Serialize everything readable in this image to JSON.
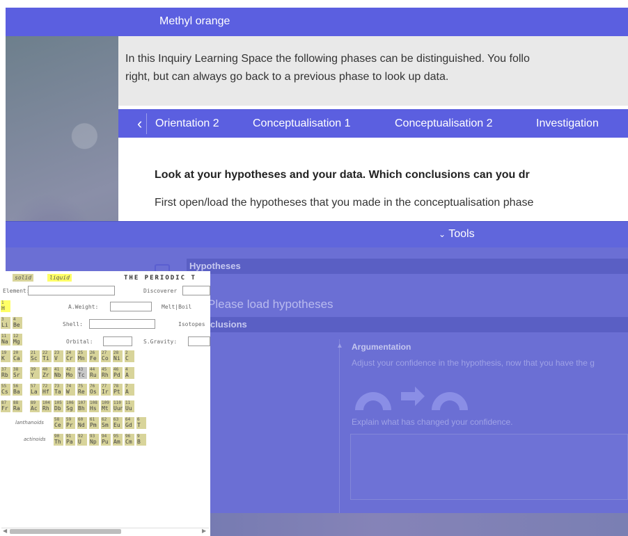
{
  "window": {
    "title": "Methyl orange"
  },
  "intro": {
    "line1": "In this Inquiry Learning Space the following phases can be distinguished. You follo",
    "line2": "right, but can always go back to a previous phase to look up data."
  },
  "phases": {
    "prev_icon": "chevron-left-icon",
    "tabs": [
      "Orientation 2",
      "Conceptualisation 1",
      "Conceptualisation 2",
      "Investigation"
    ]
  },
  "content": {
    "question": "Look at your hypotheses and your data. Which conclusions can you dr",
    "instruction": "First open/load the hypotheses that you made in the conceptualisation phase"
  },
  "tools": {
    "label": "Tools",
    "toggle_icon": "chevron-down-icon",
    "hypotheses": {
      "title": "Hypotheses",
      "empty_text": "Please load hypotheses"
    },
    "conclusions": {
      "title": "clusions",
      "argumentation_title": "Argumentation",
      "argumentation_hint": "Adjust your confidence in the hypothesis, now that you have the g",
      "explain_label": "Explain what has changed your confidence."
    }
  },
  "periodic_table": {
    "legend": {
      "solid": "solid",
      "liquid": "liquid"
    },
    "title": "THE PERIODIC T",
    "fields": {
      "element": "Element:",
      "discoverer": "Discoverer",
      "a_weight": "A.Weight:",
      "melt_boil": "Melt|Boil",
      "shell": "Shell:",
      "isotopes": "Isotopes",
      "orbital": "Orbital:",
      "s_gravity": "S.Gravity:"
    },
    "series": {
      "lanthanoids": "lanthanoids",
      "actinoids": "actinoids"
    },
    "colors": {
      "solid": "#d8d49a",
      "liquid": "#ffff66",
      "synthetic": "#c8c8c8",
      "gas": "#ffff66"
    },
    "cells": [
      {
        "n": "1",
        "s": "H"
      },
      {
        "n": "3",
        "s": "Li"
      },
      {
        "n": "4",
        "s": "Be"
      },
      {
        "n": "11",
        "s": "Na"
      },
      {
        "n": "12",
        "s": "Mg"
      },
      {
        "n": "19",
        "s": "K"
      },
      {
        "n": "20",
        "s": "Ca"
      },
      {
        "n": "21",
        "s": "Sc"
      },
      {
        "n": "22",
        "s": "Ti"
      },
      {
        "n": "23",
        "s": "V"
      },
      {
        "n": "24",
        "s": "Cr"
      },
      {
        "n": "25",
        "s": "Mn"
      },
      {
        "n": "26",
        "s": "Fe"
      },
      {
        "n": "27",
        "s": "Co"
      },
      {
        "n": "28",
        "s": "Ni"
      },
      {
        "n": "2",
        "s": "C"
      },
      {
        "n": "37",
        "s": "Rb"
      },
      {
        "n": "38",
        "s": "Sr"
      },
      {
        "n": "39",
        "s": "Y"
      },
      {
        "n": "40",
        "s": "Zr"
      },
      {
        "n": "41",
        "s": "Nb"
      },
      {
        "n": "42",
        "s": "Mo"
      },
      {
        "n": "43",
        "s": "Tc"
      },
      {
        "n": "44",
        "s": "Ru"
      },
      {
        "n": "45",
        "s": "Rh"
      },
      {
        "n": "46",
        "s": "Pd"
      },
      {
        "n": "4",
        "s": "A"
      },
      {
        "n": "55",
        "s": "Cs"
      },
      {
        "n": "56",
        "s": "Ba"
      },
      {
        "n": "57",
        "s": "La"
      },
      {
        "n": "72",
        "s": "Hf"
      },
      {
        "n": "73",
        "s": "Ta"
      },
      {
        "n": "74",
        "s": "W"
      },
      {
        "n": "75",
        "s": "Re"
      },
      {
        "n": "76",
        "s": "Os"
      },
      {
        "n": "77",
        "s": "Ir"
      },
      {
        "n": "78",
        "s": "Pt"
      },
      {
        "n": "7",
        "s": "A"
      },
      {
        "n": "87",
        "s": "Fr"
      },
      {
        "n": "88",
        "s": "Ra"
      },
      {
        "n": "89",
        "s": "Ac"
      },
      {
        "n": "104",
        "s": "Rh"
      },
      {
        "n": "105",
        "s": "Db"
      },
      {
        "n": "106",
        "s": "Sg"
      },
      {
        "n": "107",
        "s": "Bh"
      },
      {
        "n": "108",
        "s": "Hs"
      },
      {
        "n": "109",
        "s": "Mt"
      },
      {
        "n": "110",
        "s": "Uun"
      },
      {
        "n": "11",
        "s": "Uu"
      }
    ],
    "lanthanoids": [
      {
        "n": "58",
        "s": "Ce"
      },
      {
        "n": "59",
        "s": "Pr"
      },
      {
        "n": "60",
        "s": "Nd"
      },
      {
        "n": "61",
        "s": "Pm"
      },
      {
        "n": "62",
        "s": "Sm"
      },
      {
        "n": "63",
        "s": "Eu"
      },
      {
        "n": "64",
        "s": "Gd"
      },
      {
        "n": "6",
        "s": "T"
      }
    ],
    "actinoids": [
      {
        "n": "90",
        "s": "Th"
      },
      {
        "n": "91",
        "s": "Pa"
      },
      {
        "n": "92",
        "s": "U"
      },
      {
        "n": "93",
        "s": "Np"
      },
      {
        "n": "94",
        "s": "Pu"
      },
      {
        "n": "95",
        "s": "Am"
      },
      {
        "n": "96",
        "s": "Cm"
      },
      {
        "n": "9",
        "s": "B"
      }
    ]
  }
}
